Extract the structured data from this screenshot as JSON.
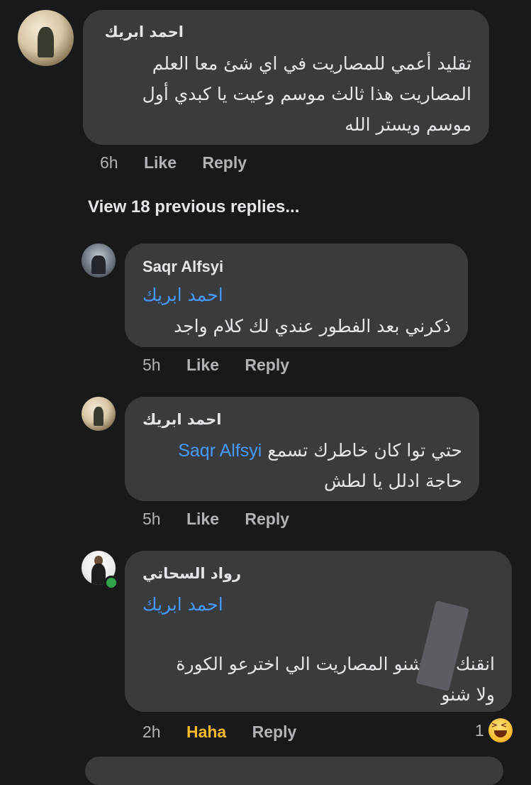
{
  "comments": [
    {
      "author": "احمد ابريك",
      "lines": [
        "تقليد أعمي للمصاريت في اي شئ معا العلم",
        "المصاريت هذا ثالث موسم وعيت يا كبدي أول",
        "موسم ويستر الله"
      ],
      "time": "6h",
      "like": "Like",
      "reply": "Reply"
    }
  ],
  "view_previous": "View 18 previous replies...",
  "replies": [
    {
      "author": "Saqr Alfsyi",
      "mention": "احمد ابريك",
      "lines": [
        "ذكرني بعد الفطور عندي لك كلام واجد"
      ],
      "time": "5h",
      "like": "Like",
      "reply": "Reply"
    },
    {
      "author": "احمد ابريك",
      "mention": "Saqr Alfsyi",
      "line1_rest": "حتي توا كان خاطرك تسمع",
      "line2": "حاجة ادلل يا لطش",
      "time": "5h",
      "like": "Like",
      "reply": "Reply"
    },
    {
      "author": "رواد السحاتي",
      "mention": "احمد ابريك",
      "line1a": "انقنك",
      "line1b": "شنو المصاريت الي اخترعو الكورة",
      "line2": "ولا شنو",
      "time": "2h",
      "like": "Haha",
      "reply": "Reply",
      "reaction_count": "1",
      "reaction_icon": "haha-emoji-icon"
    }
  ],
  "colors": {
    "background": "#18191a",
    "bubble": "#3a3b3c",
    "mention": "#4599ff",
    "haha": "#f7b928",
    "online": "#31a24c"
  }
}
